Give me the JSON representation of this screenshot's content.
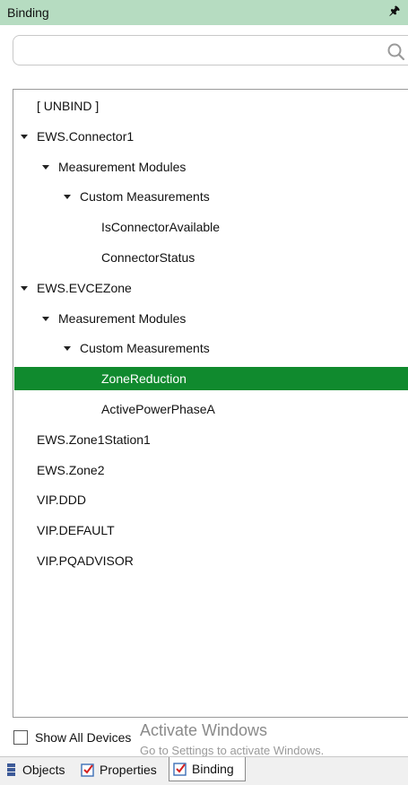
{
  "panel": {
    "title": "Binding"
  },
  "search": {
    "value": "",
    "placeholder": ""
  },
  "tree": [
    {
      "label": "[ UNBIND ]",
      "level": 0,
      "expandable": false,
      "selected": false
    },
    {
      "label": "EWS.Connector1",
      "level": 0,
      "expandable": true,
      "selected": false
    },
    {
      "label": "Measurement Modules",
      "level": 1,
      "expandable": true,
      "selected": false
    },
    {
      "label": "Custom Measurements",
      "level": 2,
      "expandable": true,
      "selected": false
    },
    {
      "label": "IsConnectorAvailable",
      "level": 3,
      "expandable": false,
      "selected": false
    },
    {
      "label": "ConnectorStatus",
      "level": 3,
      "expandable": false,
      "selected": false
    },
    {
      "label": "EWS.EVCEZone",
      "level": 0,
      "expandable": true,
      "selected": false
    },
    {
      "label": "Measurement Modules",
      "level": 1,
      "expandable": true,
      "selected": false
    },
    {
      "label": "Custom Measurements",
      "level": 2,
      "expandable": true,
      "selected": false
    },
    {
      "label": "ZoneReduction",
      "level": 3,
      "expandable": false,
      "selected": true
    },
    {
      "label": "ActivePowerPhaseA",
      "level": 3,
      "expandable": false,
      "selected": false
    },
    {
      "label": "EWS.Zone1Station1",
      "level": 0,
      "expandable": false,
      "selected": false
    },
    {
      "label": "EWS.Zone2",
      "level": 0,
      "expandable": false,
      "selected": false
    },
    {
      "label": "VIP.DDD",
      "level": 0,
      "expandable": false,
      "selected": false
    },
    {
      "label": "VIP.DEFAULT",
      "level": 0,
      "expandable": false,
      "selected": false
    },
    {
      "label": "VIP.PQADVISOR",
      "level": 0,
      "expandable": false,
      "selected": false
    }
  ],
  "show_all_devices": {
    "label": "Show All Devices",
    "checked": false
  },
  "watermark": {
    "title": "Activate Windows",
    "subtitle": "Go to Settings to activate Windows."
  },
  "tabs": [
    {
      "label": "Objects",
      "icon": "objects-icon",
      "active": false
    },
    {
      "label": "Properties",
      "icon": "properties-icon",
      "active": false
    },
    {
      "label": "Binding",
      "icon": "binding-icon",
      "active": true
    }
  ],
  "colors": {
    "title_bar": "#b6dcc1",
    "selection": "#108a2e"
  }
}
